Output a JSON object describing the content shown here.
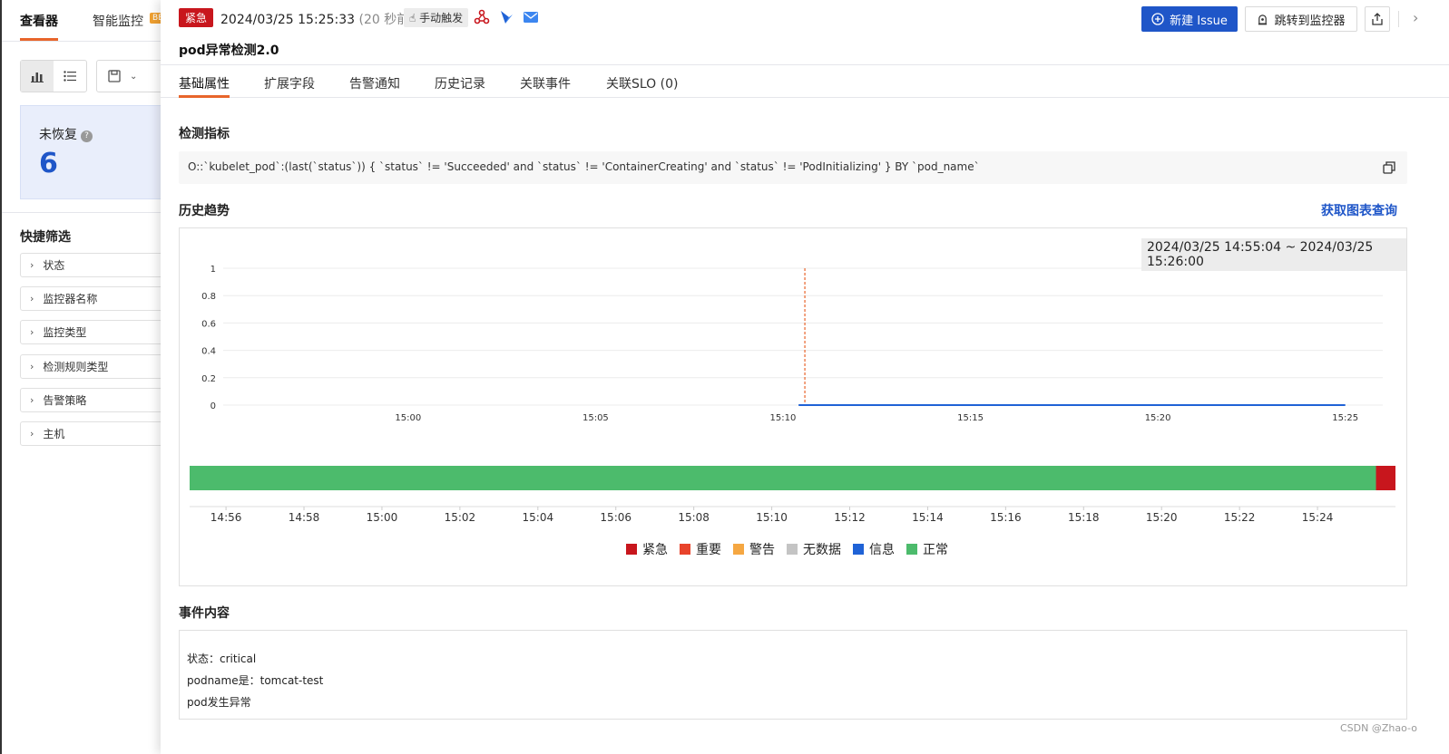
{
  "background": {
    "tabs": [
      "查看器",
      "智能监控"
    ],
    "beta_badge": "BE",
    "unrecovered": {
      "label": "未恢复",
      "count": "6"
    },
    "quick_filter": {
      "title": "快捷筛选",
      "items": [
        "状态",
        "监控器名称",
        "监控类型",
        "检测规则类型",
        "告警策略",
        "主机"
      ]
    }
  },
  "header": {
    "severity": "紧急",
    "time": "2024/03/25 15:25:33",
    "ago": "(20 秒前)",
    "trigger": "手动触发",
    "new_issue": "新建 Issue",
    "jump_monitor": "跳转到监控器"
  },
  "title": "pod异常检测2.0",
  "tabs": [
    "基础属性",
    "扩展字段",
    "告警通知",
    "历史记录",
    "关联事件",
    "关联SLO (0)"
  ],
  "sections": {
    "metric_title": "检测指标",
    "metric_query": "O::`kubelet_pod`:(last(`status`)) { `status` != 'Succeeded' and `status` != 'ContainerCreating' and `status` != 'PodInitializing' } BY `pod_name`",
    "trend_title": "历史趋势",
    "trend_link": "获取图表查询",
    "time_range": "2024/03/25 14:55:04 ~ 2024/03/25 15:26:00",
    "event_title": "事件内容",
    "event_lines": [
      "状态：critical",
      "podname是：tomcat-test",
      "pod发生异常"
    ]
  },
  "chart_data": [
    {
      "type": "line",
      "x_ticks": [
        "15:00",
        "15:05",
        "15:10",
        "15:15",
        "15:20",
        "15:25"
      ],
      "y_ticks": [
        "0",
        "0.2",
        "0.4",
        "0.6",
        "0.8",
        "1"
      ],
      "ylim": [
        0,
        1
      ],
      "xlim": [
        "14:55:04",
        "15:26:00"
      ],
      "series": [
        {
          "x": [
            "15:10:25",
            "15:25:00"
          ],
          "values": [
            0,
            0
          ],
          "color": "#1f62d6"
        }
      ],
      "marker_x": "15:10:35",
      "marker_color": "#e8652b",
      "grid": true
    },
    {
      "type": "bar",
      "orientation": "status-timeline",
      "x_ticks": [
        "14:56",
        "14:58",
        "15:00",
        "15:02",
        "15:04",
        "15:06",
        "15:08",
        "15:10",
        "15:12",
        "15:14",
        "15:16",
        "15:18",
        "15:20",
        "15:22",
        "15:24"
      ],
      "segments": [
        {
          "status": "正常",
          "from": "14:55:04",
          "to": "15:25:30"
        },
        {
          "status": "紧急",
          "from": "15:25:30",
          "to": "15:26:00"
        }
      ],
      "legend": [
        {
          "name": "紧急",
          "color": "#c8161d"
        },
        {
          "name": "重要",
          "color": "#e8432b"
        },
        {
          "name": "警告",
          "color": "#f5a742"
        },
        {
          "name": "无数据",
          "color": "#c4c4c4"
        },
        {
          "name": "信息",
          "color": "#1f62d6"
        },
        {
          "name": "正常",
          "color": "#4cbb6c"
        }
      ]
    }
  ],
  "watermark": "CSDN @Zhao-o"
}
